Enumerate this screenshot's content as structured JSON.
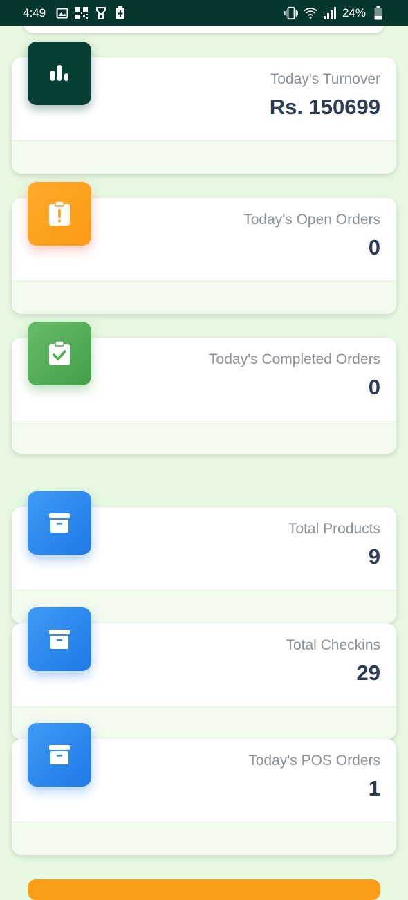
{
  "status_bar": {
    "time": "4:49",
    "battery": "24%",
    "left_icons": [
      "image-icon",
      "qr-code-icon",
      "flashlight-icon",
      "battery-saver-icon"
    ],
    "right_icons": [
      "vibrate-icon",
      "wifi-icon",
      "signal-icon",
      "battery-icon"
    ]
  },
  "colors": {
    "status_bar_bg": "#06372f",
    "page_bg": "#e6f8e0",
    "value_text": "#2e3b55",
    "label_text": "#8a8f99",
    "tile_dark": "#073f36",
    "tile_orange": "#fb9a14",
    "tile_green": "#43a047",
    "tile_blue": "#1e79e6"
  },
  "cards": [
    {
      "label": "Today's Turnover",
      "value": "Rs. 150699",
      "icon": "bar-chart-icon"
    },
    {
      "label": "Today's Open Orders",
      "value": "0",
      "icon": "clipboard-alert-icon"
    },
    {
      "label": "Today's Completed Orders",
      "value": "0",
      "icon": "clipboard-check-icon"
    },
    {
      "label": "Total Products",
      "value": "9",
      "icon": "archive-box-icon"
    },
    {
      "label": "Total Checkins",
      "value": "29",
      "icon": "archive-box-icon"
    },
    {
      "label": "Today's POS Orders",
      "value": "1",
      "icon": "archive-box-icon"
    }
  ]
}
